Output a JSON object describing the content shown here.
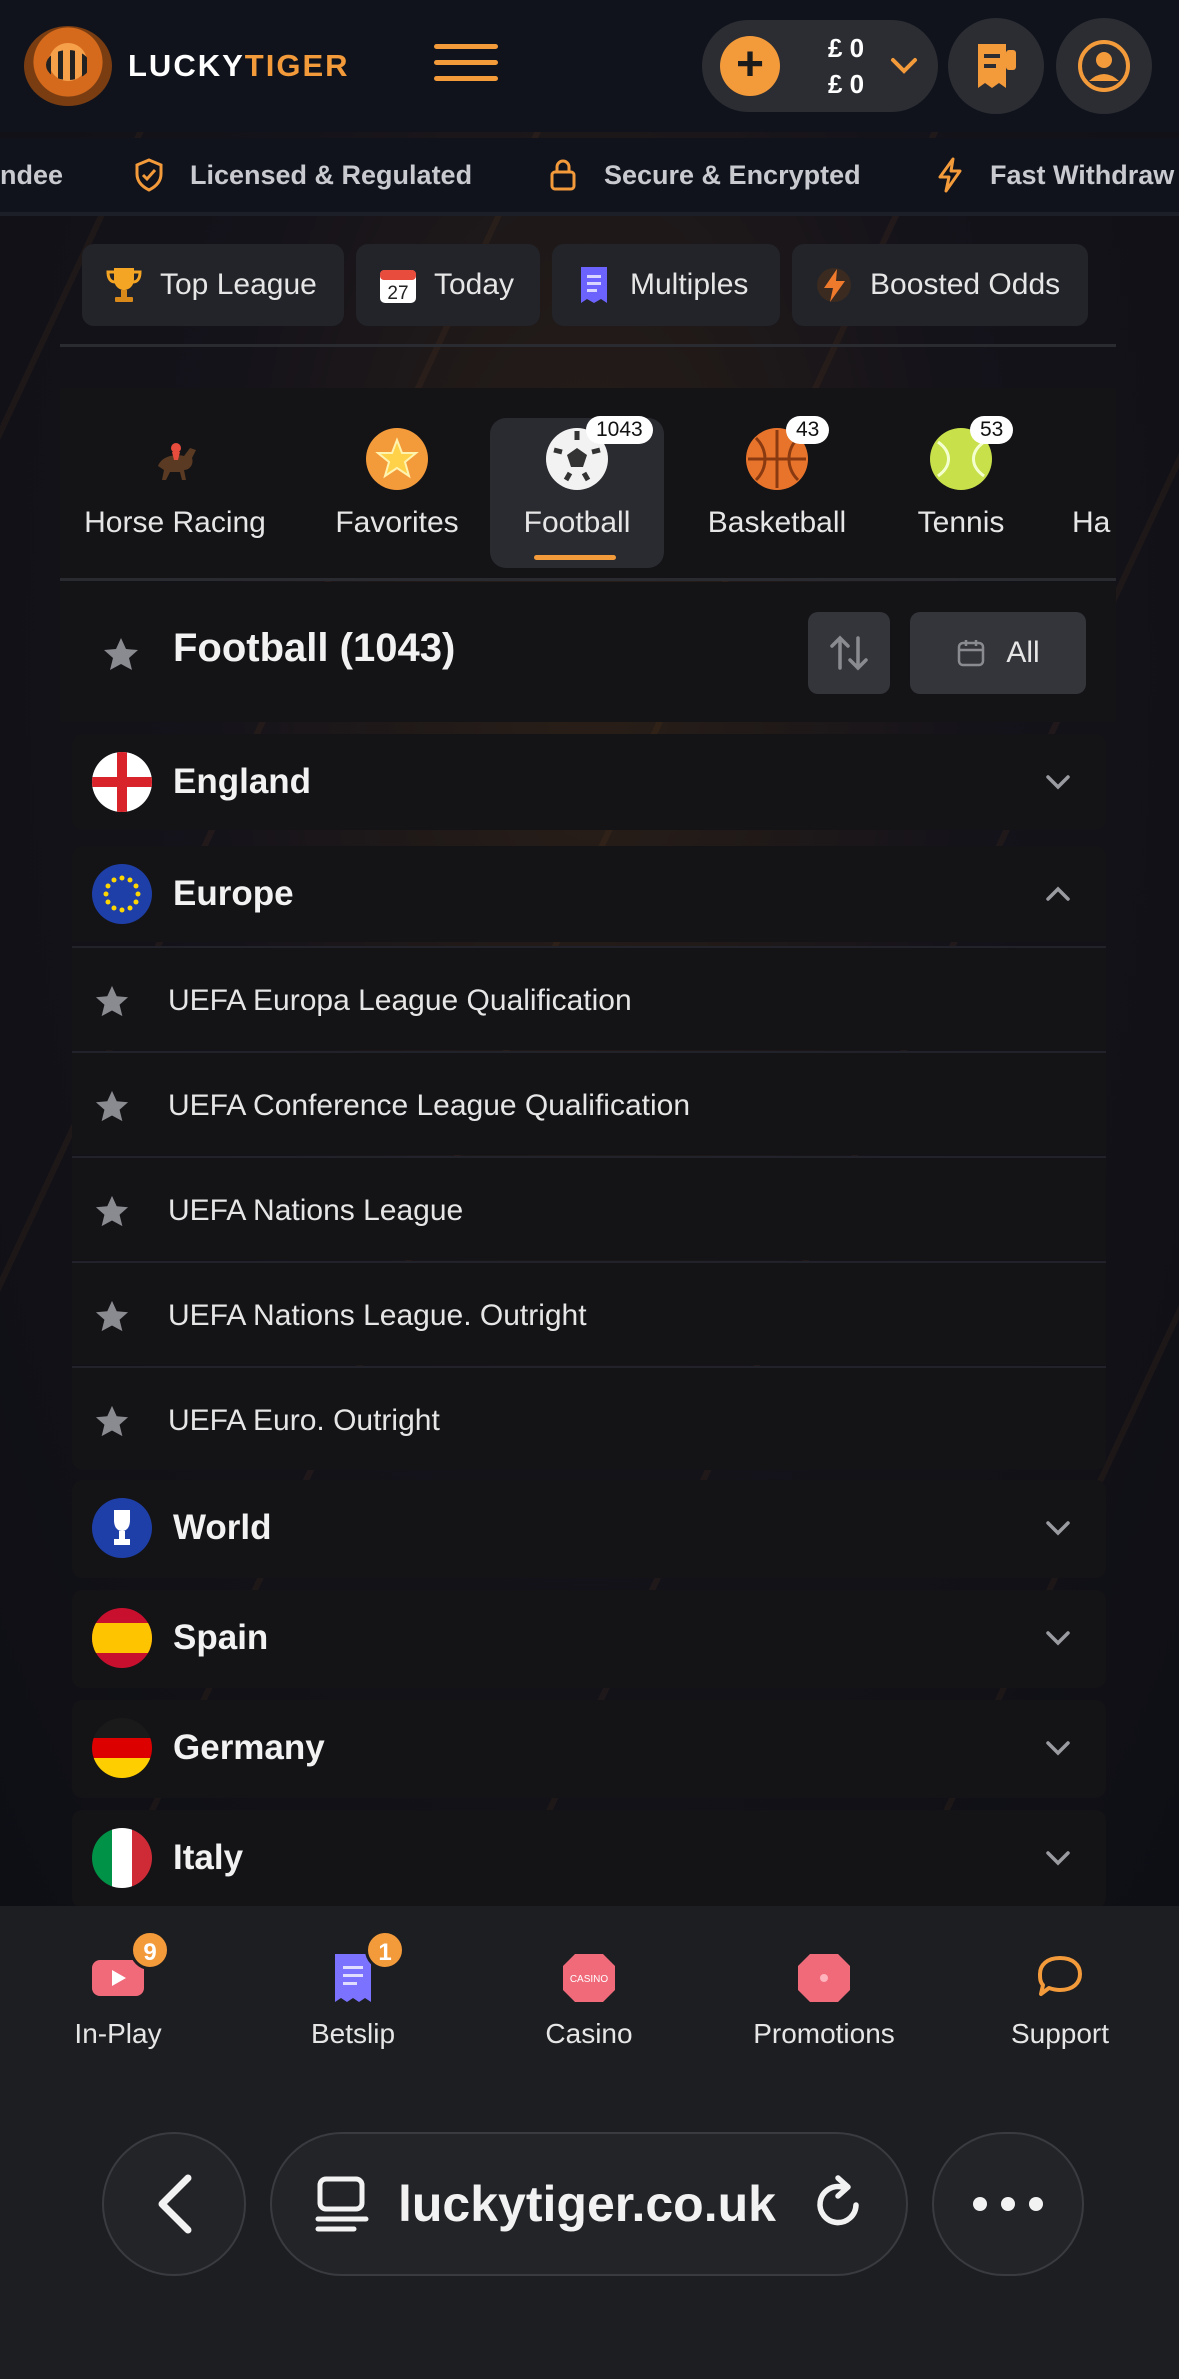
{
  "brand": {
    "name_part1": "LUCKY",
    "name_part2": "TIGER",
    "accent": "#f39a3b"
  },
  "wallet": {
    "balance1": "£ 0",
    "balance2": "£ 0"
  },
  "ticker": [
    {
      "label": "ndee",
      "icon": "none"
    },
    {
      "label": "Licensed & Regulated",
      "icon": "shield-check-icon"
    },
    {
      "label": "Secure & Encrypted",
      "icon": "lock-icon"
    },
    {
      "label": "Fast Withdraw",
      "icon": "lightning-icon"
    }
  ],
  "quick_links": [
    {
      "label": "Top League",
      "icon": "trophy-icon"
    },
    {
      "label": "Today",
      "icon": "calendar-icon",
      "icon_text": "27"
    },
    {
      "label": "Multiples",
      "icon": "ticket-icon"
    },
    {
      "label": "Boosted Odds",
      "icon": "lightning-icon"
    }
  ],
  "sports": [
    {
      "label": "Horse Racing",
      "icon": "horse-icon",
      "count": ""
    },
    {
      "label": "Favorites",
      "icon": "star-icon",
      "count": ""
    },
    {
      "label": "Football",
      "icon": "football-icon",
      "count": "1043"
    },
    {
      "label": "Basketball",
      "icon": "basketball-icon",
      "count": "43"
    },
    {
      "label": "Tennis",
      "icon": "tennis-icon",
      "count": "53"
    },
    {
      "label": "Ha",
      "icon": "none",
      "count": ""
    }
  ],
  "section": {
    "title": "Football (1043)",
    "filter_label": "All"
  },
  "countries": {
    "england": "England",
    "europe": "Europe",
    "world": "World",
    "spain": "Spain",
    "germany": "Germany",
    "italy": "Italy"
  },
  "europe_leagues": [
    "UEFA Europa League Qualification",
    "UEFA Conference League Qualification",
    "UEFA Nations League",
    "UEFA Nations League. Outright",
    "UEFA Euro. Outright"
  ],
  "bottom_nav": [
    {
      "label": "In-Play",
      "badge": "9"
    },
    {
      "label": "Betslip",
      "badge": "1"
    },
    {
      "label": "Casino",
      "icon_text": "CASINO"
    },
    {
      "label": "Promotions"
    },
    {
      "label": "Support"
    }
  ],
  "browser": {
    "url": "luckytiger.co.uk"
  }
}
